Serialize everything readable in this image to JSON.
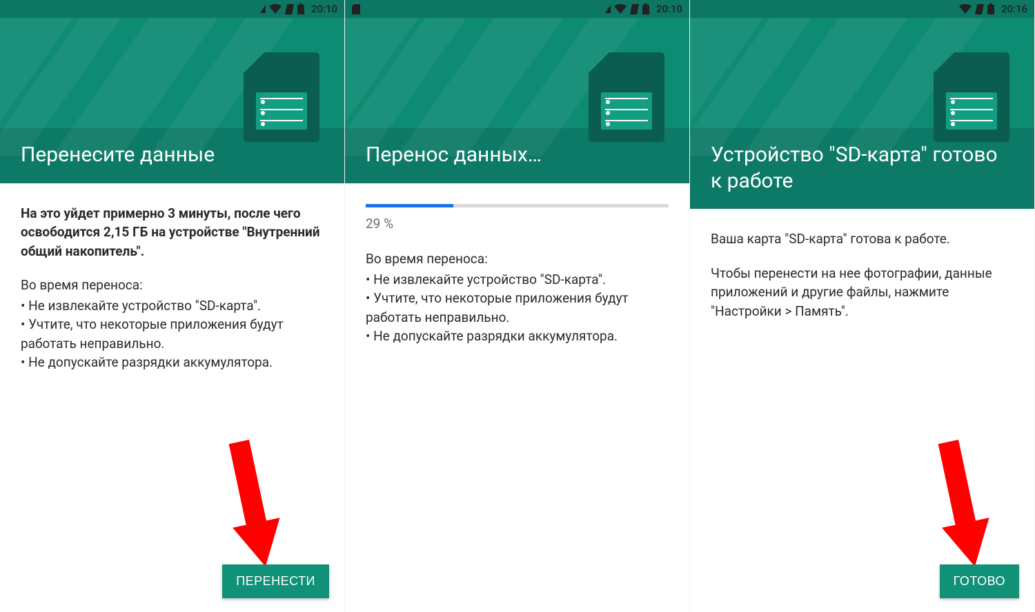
{
  "colors": {
    "primary": "#0d8b73",
    "primaryDark": "#0c7a67",
    "button": "#119178",
    "progress": "#1a73e8",
    "arrow": "#ff0000"
  },
  "screens": [
    {
      "statusbar": {
        "time": "20:10",
        "show_sd_left": false,
        "show_signal_tri": true,
        "show_wifi": true,
        "show_parallelogram": true,
        "show_battery": true
      },
      "title": "Перенесите данные",
      "lead_bold": "На это уйдет примерно 3 минуты, после чего освободится 2,15 ГБ на устройстве \"Внутренний общий накопитель\".",
      "progress": null,
      "warnings_intro": "Во время переноса:",
      "warnings": [
        "Не извлекайте устройство \"SD-карта\".",
        "Учтите, что некоторые приложения будут работать неправильно.",
        "Не допускайте разрядки аккумулятора."
      ],
      "paragraphs": [],
      "button": "ПЕРЕНЕСТИ",
      "has_arrow": true
    },
    {
      "statusbar": {
        "time": "20:10",
        "show_sd_left": true,
        "show_signal_tri": true,
        "show_wifi": true,
        "show_parallelogram": true,
        "show_battery": true
      },
      "title": "Перенос данных…",
      "lead_bold": null,
      "progress": {
        "percent": 29,
        "label": "29 %"
      },
      "warnings_intro": "Во время переноса:",
      "warnings": [
        "Не извлекайте устройство \"SD-карта\".",
        "Учтите, что некоторые приложения будут работать неправильно.",
        "Не допускайте разрядки аккумулятора."
      ],
      "paragraphs": [],
      "button": null,
      "has_arrow": false
    },
    {
      "statusbar": {
        "time": "20:16",
        "show_sd_left": false,
        "show_signal_tri": false,
        "show_wifi": true,
        "show_parallelogram": true,
        "show_battery": true
      },
      "title": "Устройство \"SD-карта\" готово к работе",
      "lead_bold": null,
      "progress": null,
      "warnings_intro": null,
      "warnings": [],
      "paragraphs": [
        "Ваша карта \"SD-карта\" готова к работе.",
        "Чтобы перенести на нее фотографии, данные приложений и другие файлы, нажмите \"Настройки > Память\"."
      ],
      "button": "ГОТОВО",
      "has_arrow": true
    }
  ]
}
